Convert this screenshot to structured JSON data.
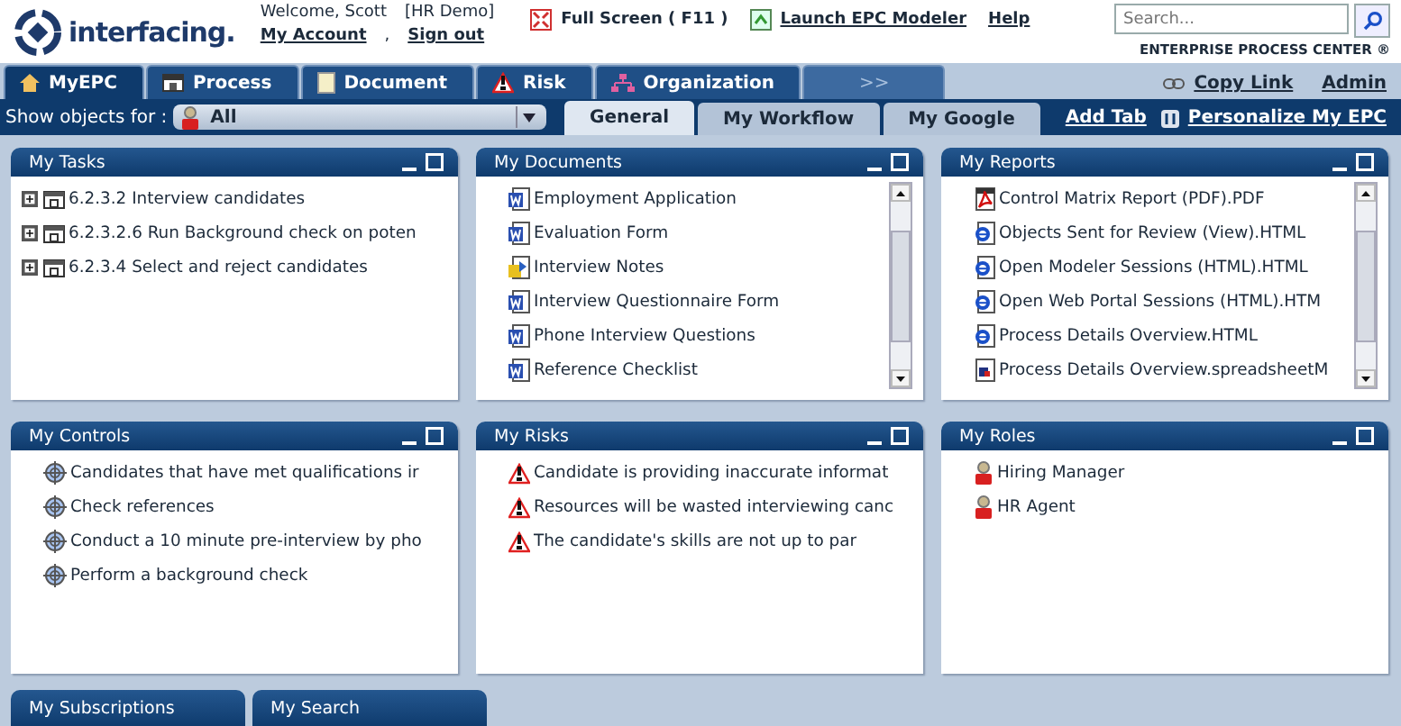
{
  "header": {
    "logo_text": "interfacing.",
    "welcome": "Welcome, Scott",
    "context": "[HR Demo]",
    "account_links": [
      {
        "label": "My Account"
      },
      {
        "label": "Sign out"
      }
    ],
    "separator": ",",
    "full_screen": "Full Screen ( F11 )",
    "launch": "Launch EPC Modeler",
    "help": "Help",
    "search": {
      "placeholder": "Search..."
    },
    "tagline": "ENTERPRISE PROCESS CENTER ®"
  },
  "main_tabs": [
    {
      "label": "MyEPC",
      "kind": "home",
      "selected": true
    },
    {
      "label": "Process",
      "kind": "process",
      "selected": false
    },
    {
      "label": "Document",
      "kind": "document",
      "selected": false
    },
    {
      "label": "Risk",
      "kind": "risk",
      "selected": false
    },
    {
      "label": "Organization",
      "kind": "organization",
      "selected": false
    },
    {
      "label": ">>",
      "kind": "more",
      "selected": false
    }
  ],
  "top_links": [
    {
      "label": "Copy Link",
      "kind": "link"
    },
    {
      "label": "Admin",
      "kind": "plain"
    }
  ],
  "filter": {
    "label": "Show objects for :",
    "value": "All"
  },
  "sub_tabs": [
    {
      "label": "General",
      "selected": true
    },
    {
      "label": "My Workflow",
      "selected": false
    },
    {
      "label": "My Google",
      "selected": false
    }
  ],
  "add_tab": "Add Tab",
  "personalize": "Personalize My EPC",
  "panels": [
    {
      "title": "My Tasks",
      "scrollbar": false,
      "items": [
        {
          "text": "6.2.3.2 Interview candidates",
          "kind": "task",
          "expanded": false
        },
        {
          "text": "6.2.3.2.6 Run Background check on poten",
          "kind": "task",
          "expanded": false
        },
        {
          "text": "6.2.3.4 Select and reject candidates",
          "kind": "task",
          "expanded": false
        }
      ]
    },
    {
      "title": "My Documents",
      "scrollbar": true,
      "items": [
        {
          "text": "Employment Application",
          "kind": "word"
        },
        {
          "text": "Evaluation Form",
          "kind": "word"
        },
        {
          "text": "Interview Notes",
          "kind": "notes"
        },
        {
          "text": "Interview Questionnaire Form",
          "kind": "word"
        },
        {
          "text": "Phone Interview Questions",
          "kind": "word"
        },
        {
          "text": "Reference Checklist",
          "kind": "word"
        }
      ]
    },
    {
      "title": "My Reports",
      "scrollbar": true,
      "items": [
        {
          "text": "Control Matrix Report (PDF).PDF",
          "kind": "pdf"
        },
        {
          "text": "Objects Sent for Review (View).HTML",
          "kind": "html"
        },
        {
          "text": "Open Modeler Sessions (HTML).HTML",
          "kind": "html"
        },
        {
          "text": "Open Web Portal Sessions (HTML).HTM",
          "kind": "html"
        },
        {
          "text": "Process Details Overview.HTML",
          "kind": "html"
        },
        {
          "text": "Process Details Overview.spreadsheetM",
          "kind": "sheet"
        }
      ]
    },
    {
      "title": "My Controls",
      "scrollbar": false,
      "items": [
        {
          "text": "Candidates that have met qualifications ir",
          "kind": "control"
        },
        {
          "text": "Check references",
          "kind": "control"
        },
        {
          "text": "Conduct a 10 minute pre-interview by pho",
          "kind": "control"
        },
        {
          "text": "Perform a background check",
          "kind": "control"
        }
      ]
    },
    {
      "title": "My Risks",
      "scrollbar": false,
      "items": [
        {
          "text": "Candidate is providing inaccurate informat",
          "kind": "risk"
        },
        {
          "text": "Resources will be wasted interviewing canc",
          "kind": "risk"
        },
        {
          "text": "The candidate's skills are not up to par",
          "kind": "risk"
        }
      ]
    },
    {
      "title": "My Roles",
      "scrollbar": false,
      "items": [
        {
          "text": "Hiring Manager",
          "kind": "role"
        },
        {
          "text": "HR Agent",
          "kind": "role"
        }
      ]
    }
  ],
  "collapsed_panels": [
    {
      "title": "My Subscriptions"
    },
    {
      "title": "My Search"
    }
  ]
}
